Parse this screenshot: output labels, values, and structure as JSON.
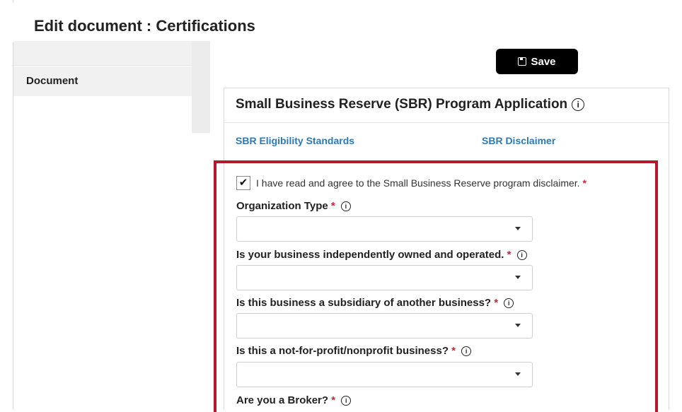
{
  "page": {
    "title": "Edit document : Certifications"
  },
  "sidebar": {
    "items": [
      {
        "label": "Document"
      }
    ]
  },
  "toolbar": {
    "save_label": "Save"
  },
  "panel": {
    "title": "Small Business Reserve (SBR) Program Application",
    "links": [
      {
        "label": "SBR Eligibility Standards"
      },
      {
        "label": "SBR Disclaimer"
      }
    ]
  },
  "form": {
    "agree": {
      "text": "I have read and agree to the Small Business Reserve program disclaimer.",
      "checked": "✔",
      "required": "*"
    },
    "fields": [
      {
        "label": "Organization Type",
        "required": "*",
        "value": ""
      },
      {
        "label": "Is your business independently owned and operated.",
        "required": "*",
        "value": ""
      },
      {
        "label": "Is this business a subsidiary of another business?",
        "required": "*",
        "value": ""
      },
      {
        "label": "Is this a not-for-profit/nonprofit business?",
        "required": "*",
        "value": ""
      },
      {
        "label": "Are you a Broker?",
        "required": "*",
        "value": ""
      }
    ]
  },
  "icons": {
    "info": "i",
    "save": "save-icon",
    "caret": "chevron-down-icon"
  },
  "colors": {
    "accent": "#b3182b",
    "link": "#2a7ab8",
    "save_bg": "#000000",
    "required": "#c9243a"
  }
}
